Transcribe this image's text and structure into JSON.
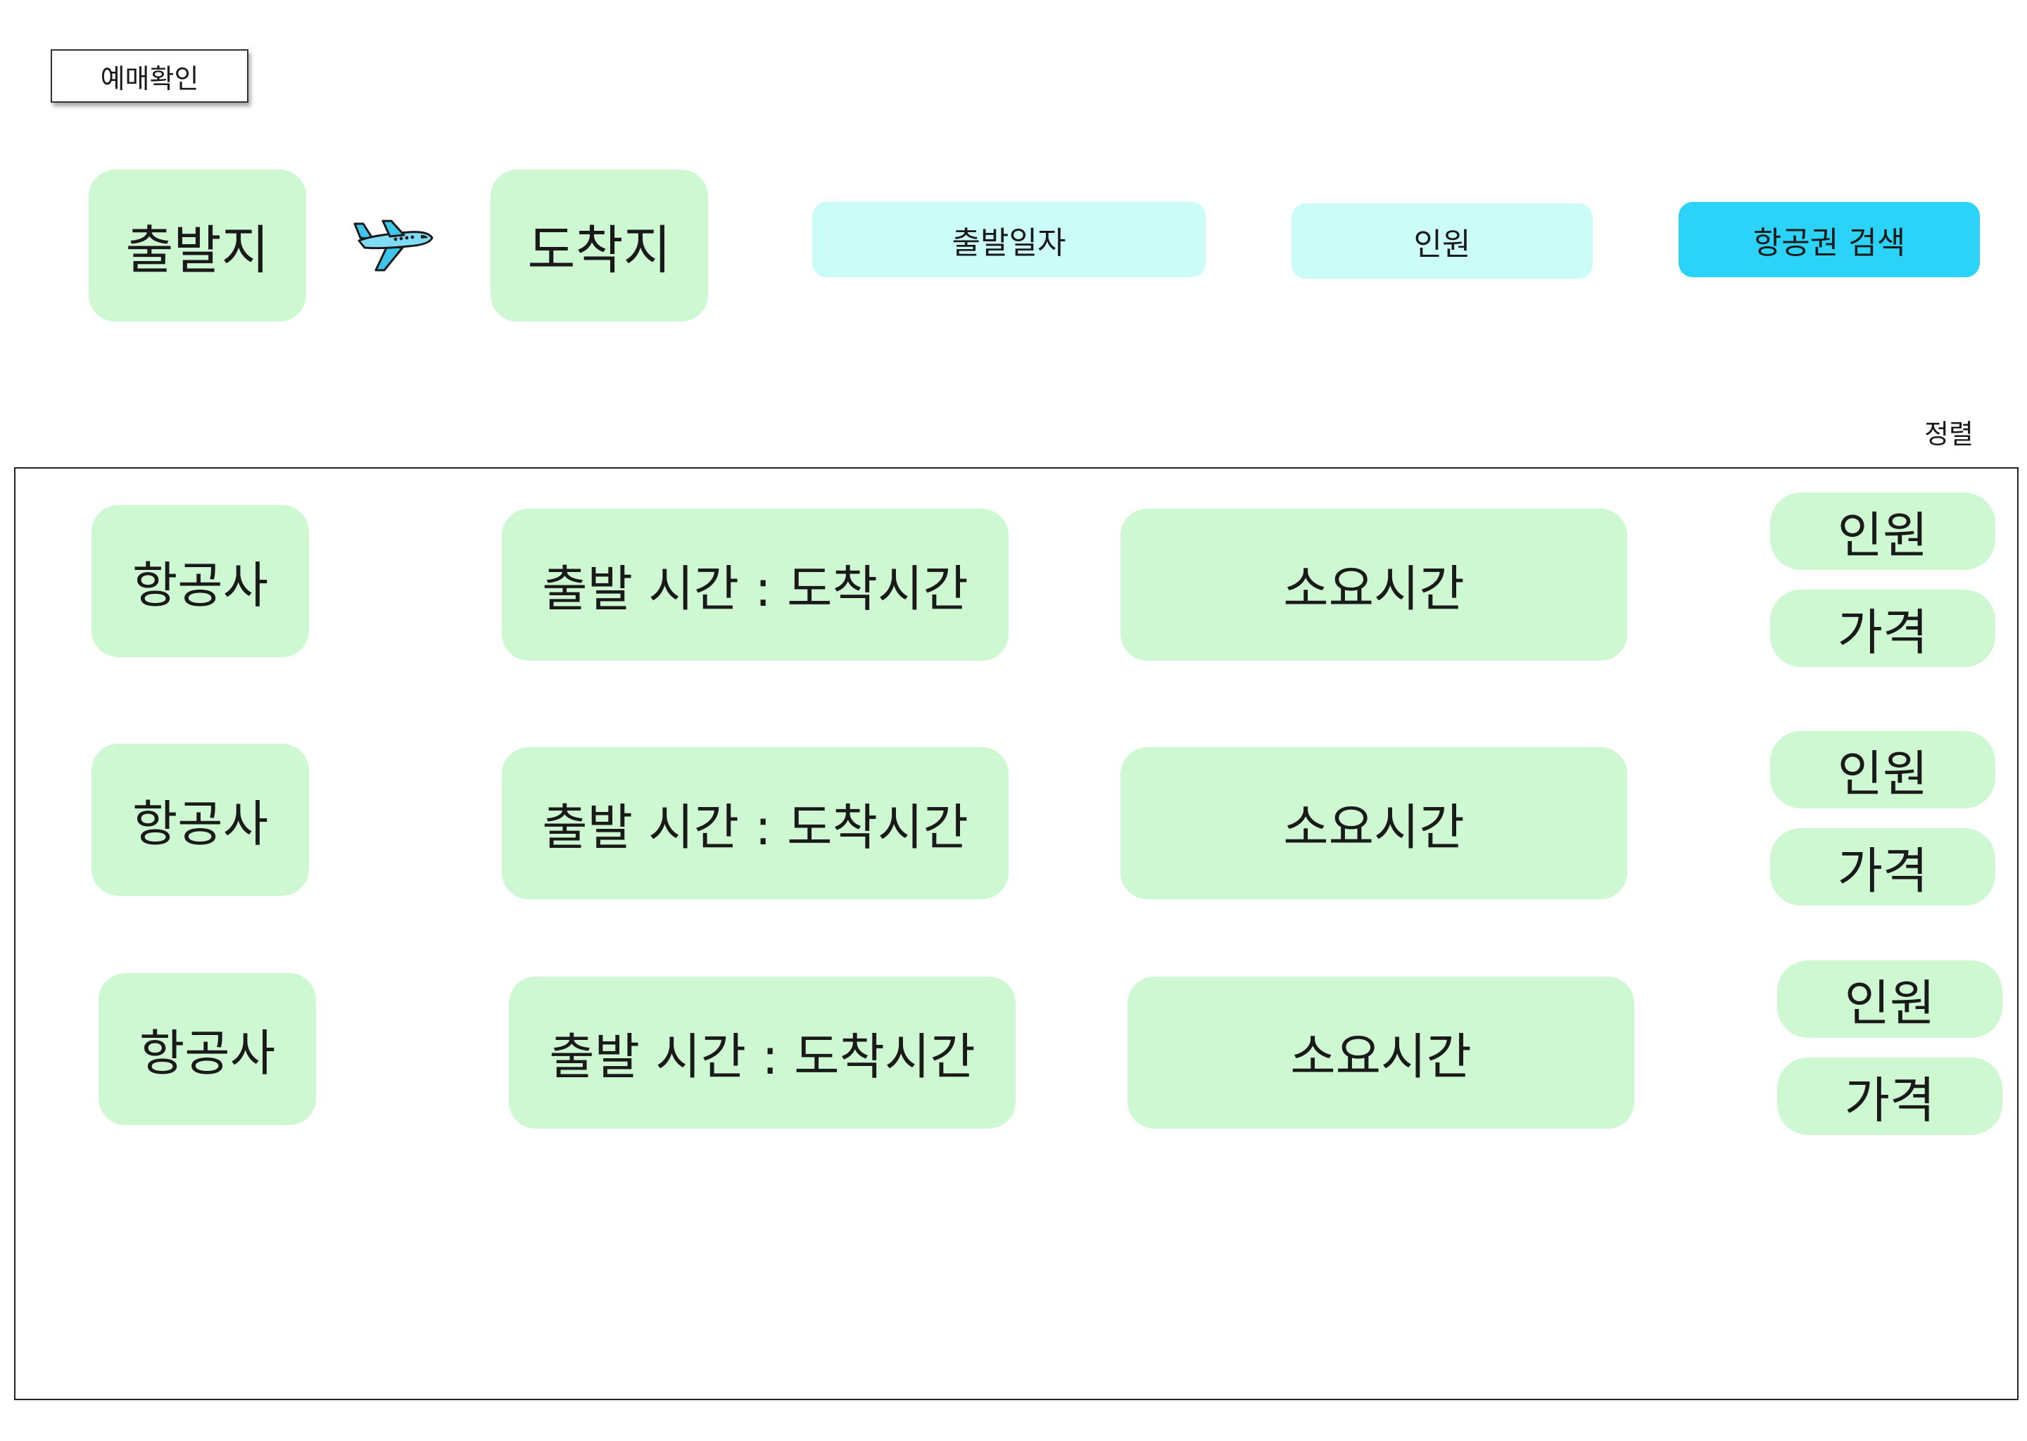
{
  "header": {
    "booking_check_label": "예매확인"
  },
  "search": {
    "origin_label": "출발지",
    "destination_label": "도착지",
    "date_label": "출발일자",
    "passengers_label": "인원",
    "search_button_label": "항공권 검색",
    "route_icon": "airplane-icon"
  },
  "results": {
    "sort_label": "정렬",
    "rows": [
      {
        "airline": "항공사",
        "times": "출발 시간 : 도착시간",
        "duration": "소요시간",
        "passengers": "인원",
        "price": "가격"
      },
      {
        "airline": "항공사",
        "times": "출발 시간 : 도착시간",
        "duration": "소요시간",
        "passengers": "인원",
        "price": "가격"
      },
      {
        "airline": "항공사",
        "times": "출발 시간 : 도착시간",
        "duration": "소요시간",
        "passengers": "인원",
        "price": "가격"
      }
    ]
  },
  "colors": {
    "box_green": "#cdf8d1",
    "field_cyan": "#ccfcf7",
    "search_button": "#2bd3f9"
  }
}
